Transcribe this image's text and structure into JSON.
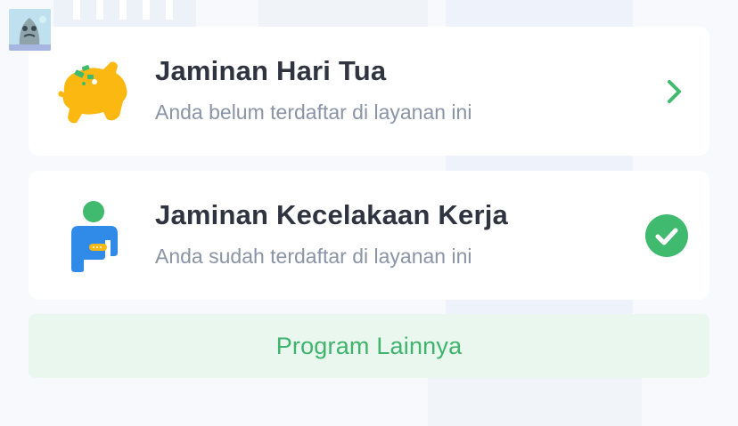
{
  "cards": [
    {
      "title": "Jaminan Hari Tua",
      "subtitle": "Anda belum terdaftar di layanan ini",
      "icon": "piggy-bank-icon",
      "action_icon": "chevron-right-icon"
    },
    {
      "title": "Jaminan Kecelakaan Kerja",
      "subtitle": "Anda sudah terdaftar di layanan ini",
      "icon": "injured-worker-icon",
      "action_icon": "check-circle-icon"
    }
  ],
  "program_button": {
    "label": "Program Lainnya"
  },
  "colors": {
    "accent_green": "#3fba6e",
    "button_bg": "#e9f7ee",
    "title_text": "#2f3440",
    "subtitle_text": "#8a94a6",
    "piggy_yellow": "#fbb810",
    "worker_blue": "#2f8ae8"
  }
}
